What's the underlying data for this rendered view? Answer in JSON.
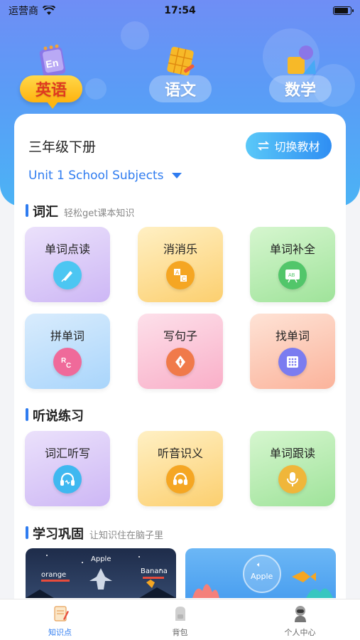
{
  "status": {
    "carrier": "运营商",
    "time": "17:54",
    "battery_level": 0.9
  },
  "subjects": [
    {
      "label": "英语",
      "icon": "english-book-icon",
      "active": true
    },
    {
      "label": "语文",
      "icon": "chinese-grid-icon",
      "active": false
    },
    {
      "label": "数学",
      "icon": "math-shapes-icon",
      "active": false
    }
  ],
  "book": {
    "grade": "三年级下册",
    "switch_label": "切换教材",
    "unit": "Unit 1 School Subjects"
  },
  "sections": {
    "vocab": {
      "title": "词汇",
      "subtitle": "轻松get课本知识"
    },
    "listening": {
      "title": "听说练习"
    },
    "review": {
      "title": "学习巩固",
      "subtitle": "让知识住在脑子里"
    }
  },
  "vocab_tiles": [
    {
      "label": "单词点读",
      "icon": "pen-touch-icon",
      "color": "#4cc6f2"
    },
    {
      "label": "消消乐",
      "icon": "abc-blocks-icon",
      "color": "#f5a623"
    },
    {
      "label": "单词补全",
      "icon": "chalkboard-icon",
      "color": "#52c66a"
    },
    {
      "label": "拼单词",
      "icon": "letters-icon",
      "color": "#ef6a9a"
    },
    {
      "label": "写句子",
      "icon": "fountain-pen-icon",
      "color": "#f07a4a"
    },
    {
      "label": "找单词",
      "icon": "letter-grid-icon",
      "color": "#7b7cf0"
    }
  ],
  "listening_tiles": [
    {
      "label": "词汇听写",
      "icon": "headphones-icon",
      "color": "#3fb8f0"
    },
    {
      "label": "听音识义",
      "icon": "headphones-face-icon",
      "color": "#f5a623"
    },
    {
      "label": "单词跟读",
      "icon": "microphone-icon",
      "color": "#f0b63a"
    }
  ],
  "banners": {
    "game": {
      "apple": "Apple",
      "orange": "orange",
      "banana": "Banana"
    },
    "sea": {
      "apple": "Apple"
    }
  },
  "tabs": [
    {
      "label": "知识点",
      "icon": "notebook-icon",
      "active": true
    },
    {
      "label": "背包",
      "icon": "backpack-icon",
      "active": false
    },
    {
      "label": "个人中心",
      "icon": "astronaut-icon",
      "active": false
    }
  ]
}
